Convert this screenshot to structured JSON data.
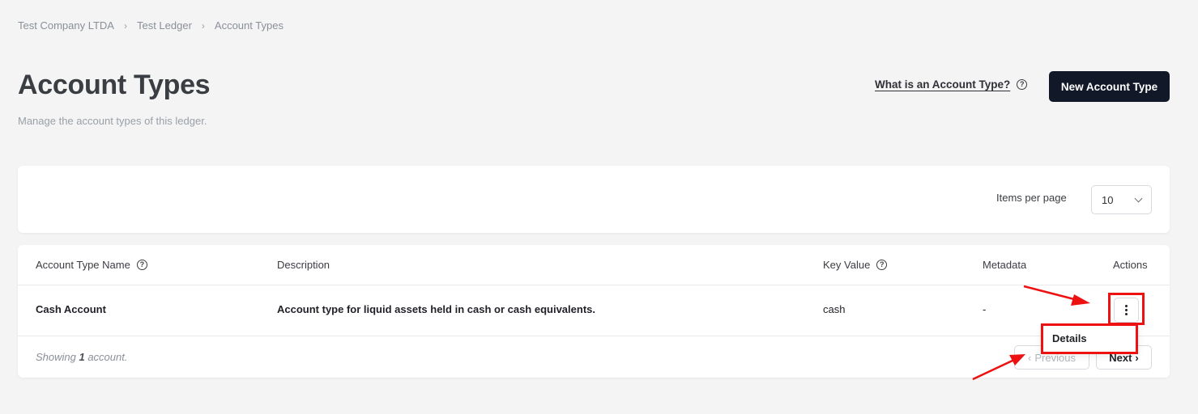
{
  "breadcrumb": {
    "items": [
      "Test Company LTDA",
      "Test Ledger",
      "Account Types"
    ]
  },
  "header": {
    "title": "Account Types",
    "subtitle": "Manage the account types of this ledger.",
    "help_link": "What is an Account Type?",
    "primary_button": "New Account Type"
  },
  "filters": {
    "items_per_page_label": "Items per page",
    "items_per_page_value": "10"
  },
  "table": {
    "columns": [
      "Account Type Name",
      "Description",
      "Key Value",
      "Metadata",
      "Actions"
    ],
    "rows": [
      {
        "name": "Cash Account",
        "description": "Account type for liquid assets held in cash or cash equivalents.",
        "key_value": "cash",
        "metadata": "-"
      }
    ],
    "footer_prefix": "Showing ",
    "footer_count": "1",
    "footer_suffix": " account.",
    "previous_label": "Previous",
    "next_label": "Next"
  },
  "actions_menu": {
    "items": [
      "Details"
    ]
  },
  "colors": {
    "primary_button_bg": "#111827",
    "annotation_red": "#ee1111",
    "page_bg": "#f4f4f4"
  }
}
